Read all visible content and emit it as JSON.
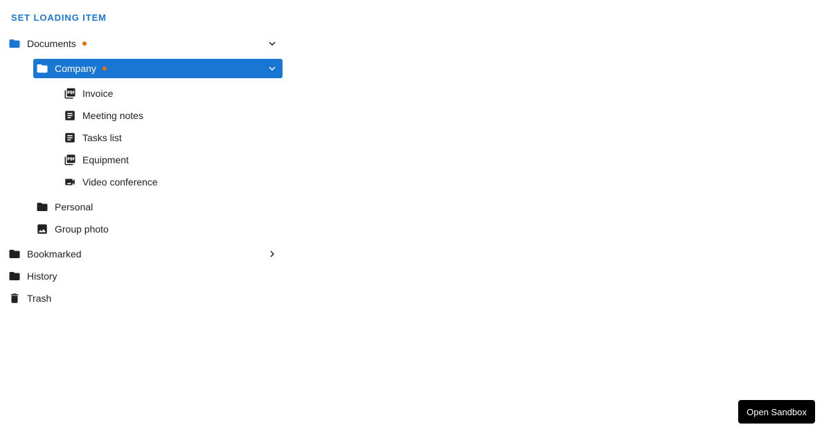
{
  "header": {
    "title": "SET LOADING ITEM"
  },
  "colors": {
    "accent": "#1976d2",
    "dot": "#ed6c02",
    "icon": "#212121",
    "selected_text": "#ffffff"
  },
  "tree": {
    "items": [
      {
        "label": "Documents",
        "icon": "folder-icon",
        "level": 0,
        "expanded": true,
        "has_dot": true,
        "selected": false
      },
      {
        "label": "Company",
        "icon": "folder-icon",
        "level": 1,
        "expanded": true,
        "has_dot": true,
        "selected": true
      },
      {
        "label": "Invoice",
        "icon": "pdf-icon",
        "level": 2
      },
      {
        "label": "Meeting notes",
        "icon": "article-icon",
        "level": 2
      },
      {
        "label": "Tasks list",
        "icon": "article-icon",
        "level": 2
      },
      {
        "label": "Equipment",
        "icon": "pdf-icon",
        "level": 2
      },
      {
        "label": "Video conference",
        "icon": "video-icon",
        "level": 2
      },
      {
        "label": "Personal",
        "icon": "folder-icon",
        "level": 1
      },
      {
        "label": "Group photo",
        "icon": "image-icon",
        "level": 1
      },
      {
        "label": "Bookmarked",
        "icon": "folder-icon",
        "level": 0,
        "expanded": false
      },
      {
        "label": "History",
        "icon": "folder-icon",
        "level": 0
      },
      {
        "label": "Trash",
        "icon": "trash-icon",
        "level": 0
      }
    ]
  },
  "footer": {
    "sandbox_label": "Open Sandbox"
  }
}
